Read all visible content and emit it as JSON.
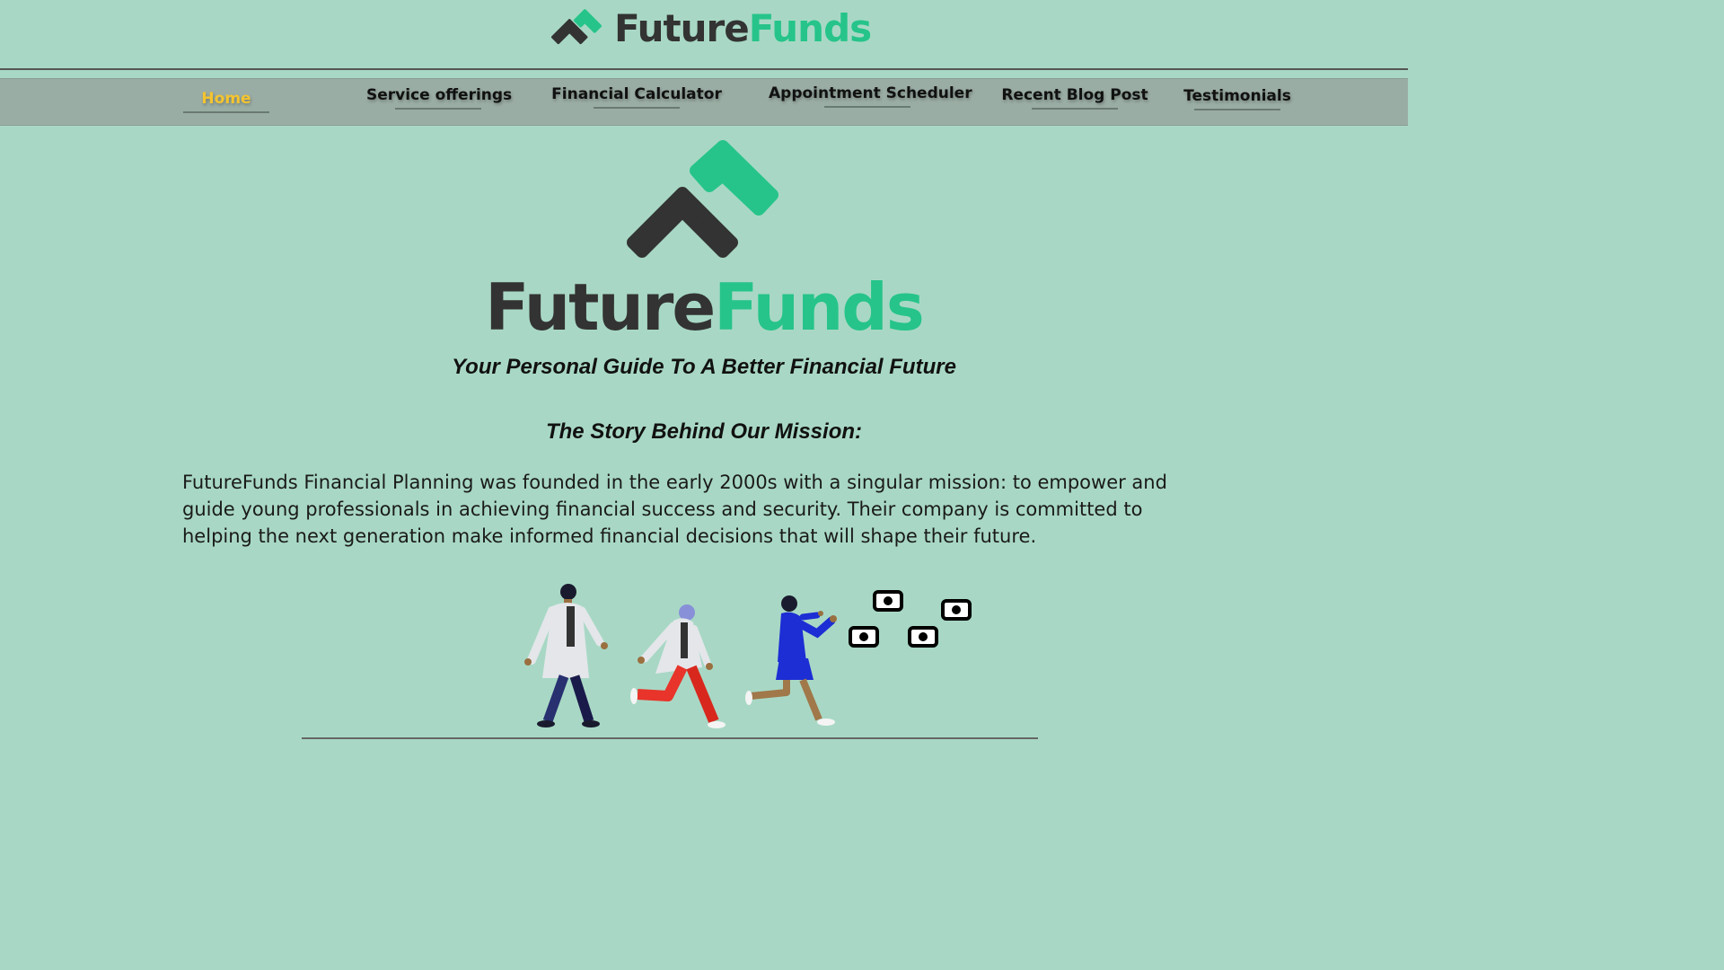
{
  "header": {
    "brand_dark": "Future",
    "brand_green": "Funds",
    "logo_icon": "futurefunds-arrow-logo-icon"
  },
  "nav": {
    "items": [
      {
        "label": "Home",
        "active": true
      },
      {
        "label": "Service offerings",
        "active": false
      },
      {
        "label": "Financial Calculator",
        "active": false
      },
      {
        "label": "Appointment Scheduler",
        "active": false
      },
      {
        "label": "Recent Blog Post",
        "active": false
      },
      {
        "label": "Testimonials",
        "active": false
      }
    ]
  },
  "hero": {
    "brand_dark": "Future",
    "brand_green": "Funds",
    "tagline": "Your Personal Guide To A Better Financial Future"
  },
  "mission": {
    "title": "The Story Behind Our Mission:",
    "body": "FutureFunds Financial Planning was founded in the early 2000s with a singular mission: to empower and guide young professionals in achieving financial success and security. Their company is committed to helping the next generation make informed financial decisions that will shape their future."
  },
  "colors": {
    "background": "#a8d8c5",
    "nav_background": "#9aada4",
    "brand_dark": "#333333",
    "brand_green": "#26c48a",
    "nav_active": "#f4c430"
  },
  "illustration": {
    "icon": "people-chasing-money-illustration"
  }
}
